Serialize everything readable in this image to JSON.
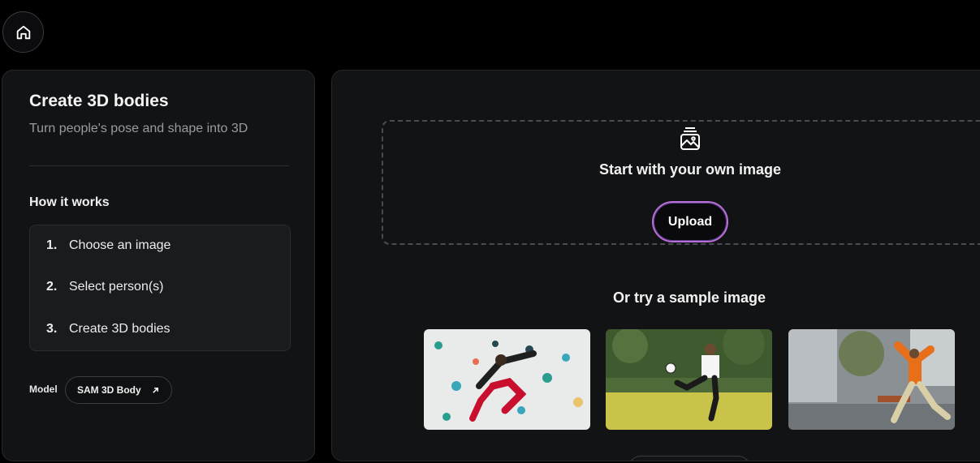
{
  "nav": {
    "home_icon": "home-icon"
  },
  "left": {
    "title": "Create 3D bodies",
    "subtitle": "Turn people's pose and shape into 3D",
    "how_title": "How it works",
    "steps": [
      {
        "num": "1.",
        "label": "Choose an image"
      },
      {
        "num": "2.",
        "label": "Select person(s)"
      },
      {
        "num": "3.",
        "label": "Create 3D bodies"
      }
    ],
    "model_label": "Model",
    "model_name": "SAM 3D Body",
    "model_icon": "arrow-up-right-icon"
  },
  "right": {
    "dropzone_icon": "image-icon",
    "dropzone_title": "Start with your own image",
    "upload_label": "Upload",
    "sample_title": "Or try a sample image",
    "samples": [
      {
        "name": "climbing-wall-sample"
      },
      {
        "name": "soccer-kick-sample"
      },
      {
        "name": "street-dance-sample"
      }
    ]
  },
  "colors": {
    "background": "#000000",
    "panel": "#121315",
    "upload_border": "#b56fd6"
  }
}
